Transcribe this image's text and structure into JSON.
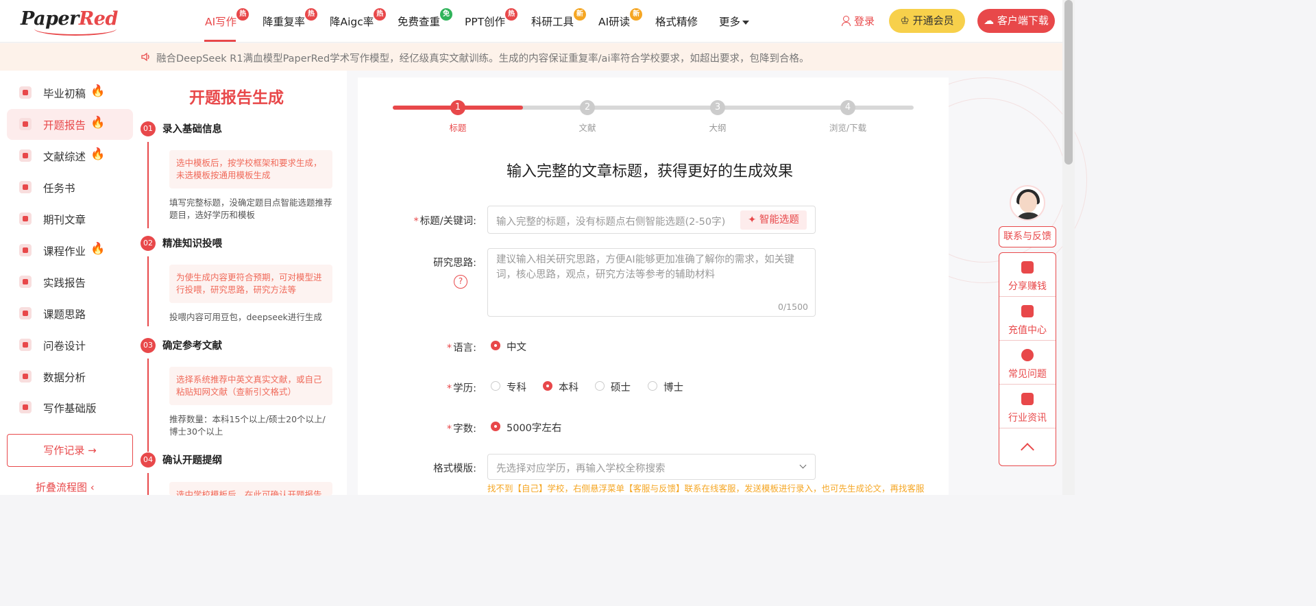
{
  "header": {
    "logo": {
      "part1": "Paper",
      "part2": "Red"
    },
    "nav": [
      {
        "label": "AI写作",
        "badge": "热",
        "badge_type": "hot",
        "active": true
      },
      {
        "label": "降重复率",
        "badge": "热",
        "badge_type": "hot"
      },
      {
        "label": "降Aigc率",
        "badge": "热",
        "badge_type": "hot"
      },
      {
        "label": "免费查重",
        "badge": "免",
        "badge_type": "free"
      },
      {
        "label": "PPT创作",
        "badge": "热",
        "badge_type": "hot"
      },
      {
        "label": "科研工具",
        "badge": "新",
        "badge_type": "new"
      },
      {
        "label": "AI研读",
        "badge": "新",
        "badge_type": "new"
      },
      {
        "label": "格式精修",
        "badge": ""
      },
      {
        "label": "更多",
        "badge": ""
      }
    ],
    "login_label": "登录",
    "vip_label": "开通会员",
    "download_label": "客户端下载"
  },
  "notice": {
    "text": "融合DeepSeek R1满血模型PaperRed学术写作模型，经亿级真实文献训练。生成的内容保证重复率/ai率符合学校要求，如超出要求，包降到合格。"
  },
  "sidebar": {
    "items": [
      {
        "label": "毕业初稿",
        "fire": true,
        "icon": "graduation-icon"
      },
      {
        "label": "开题报告",
        "fire": true,
        "icon": "report-icon",
        "active": true
      },
      {
        "label": "文献综述",
        "fire": true,
        "icon": "literature-icon"
      },
      {
        "label": "任务书",
        "fire": false,
        "icon": "task-icon"
      },
      {
        "label": "期刊文章",
        "fire": false,
        "icon": "trophy-icon"
      },
      {
        "label": "课程作业",
        "fire": true,
        "icon": "homework-icon"
      },
      {
        "label": "实践报告",
        "fire": false,
        "icon": "practice-icon"
      },
      {
        "label": "课题思路",
        "fire": false,
        "icon": "idea-icon"
      },
      {
        "label": "问卷设计",
        "fire": false,
        "icon": "survey-icon"
      },
      {
        "label": "数据分析",
        "fire": false,
        "icon": "chart-icon"
      },
      {
        "label": "写作基础版",
        "fire": false,
        "icon": "layers-icon"
      }
    ],
    "record_label": "写作记录",
    "collapse_label": "折叠流程图"
  },
  "flow": {
    "title": "开题报告生成",
    "steps": [
      {
        "num": "01",
        "title": "录入基础信息",
        "box": "选中模板后，按学校框架和要求生成，未选模板按通用模板生成",
        "desc": "填写完整标题，没确定题目点智能选题推荐题目，选好学历和模板"
      },
      {
        "num": "02",
        "title": "精准知识投喂",
        "box": "为使生成内容更符合预期，可对模型进行投喂，研究思路，研究方法等",
        "desc": "投喂内容可用豆包，deepseek进行生成"
      },
      {
        "num": "03",
        "title": "确定参考文献",
        "box": "选择系统推荐中英文真实文献，或自己粘贴知网文献（查新引文格式）",
        "desc": "推荐数量：本科15个以上/硕士20个以上/博士30个以上"
      },
      {
        "num": "04",
        "title": "确认开题提纲",
        "box": "选中学校模板后，在此可确认开题报告",
        "desc": ""
      }
    ]
  },
  "progress": {
    "fill_fraction": 0.25,
    "steps": [
      {
        "num": "1",
        "label": "标题",
        "active": true
      },
      {
        "num": "2",
        "label": "文献",
        "active": false
      },
      {
        "num": "3",
        "label": "大纲",
        "active": false
      },
      {
        "num": "4",
        "label": "浏览/下载",
        "active": false
      }
    ]
  },
  "form": {
    "heading": "输入完整的文章标题，获得更好的生成效果",
    "title_label": "标题/关键词:",
    "title_placeholder": "输入完整的标题，没有标题点右侧智能选题(2-50字)",
    "smart_btn": "智能选题",
    "idea_label": "研究思路:",
    "idea_placeholder": "建议输入相关研究思路，方便AI能够更加准确了解你的需求，如关键词，核心思路，观点，研究方法等参考的辅助材料",
    "idea_count": "0/1500",
    "lang_label": "语言:",
    "lang_options": [
      "中文"
    ],
    "edu_label": "学历:",
    "edu_options": [
      "专科",
      "本科",
      "硕士",
      "博士"
    ],
    "edu_selected": "本科",
    "words_label": "字数:",
    "words_options": [
      "5000字左右"
    ],
    "template_label": "格式模版:",
    "template_placeholder": "先选择对应学历，再输入学校全称搜索",
    "hint": "找不到【自己】学校，右侧悬浮菜单【客服与反馈】联系在线客服，发送模板进行录入，也可先生成论文，再找客服【系统处理】"
  },
  "float": {
    "contact_label": "联系与反馈",
    "items": [
      {
        "label": "分享赚钱",
        "icon": "money-bag-icon"
      },
      {
        "label": "充值中心",
        "icon": "gift-icon"
      },
      {
        "label": "常见问题",
        "icon": "question-icon"
      },
      {
        "label": "行业资讯",
        "icon": "news-icon"
      }
    ]
  },
  "colors": {
    "accent": "#e8484a",
    "vip": "#f7d04b",
    "hint": "#f5a623",
    "free_badge": "#2fb35a"
  }
}
